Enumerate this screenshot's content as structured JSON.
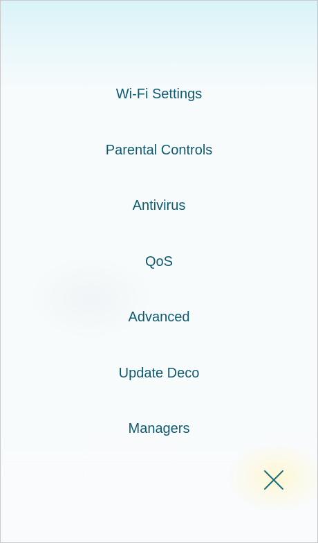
{
  "menu": {
    "items": [
      {
        "label": "Wi-Fi Settings"
      },
      {
        "label": "Parental Controls"
      },
      {
        "label": "Antivirus"
      },
      {
        "label": "QoS"
      },
      {
        "label": "Advanced"
      },
      {
        "label": "Update Deco"
      },
      {
        "label": "Managers"
      }
    ]
  },
  "close_button": {
    "icon": "close-icon"
  },
  "colors": {
    "text": "#0f5a70",
    "icon": "#1a6a7c"
  }
}
